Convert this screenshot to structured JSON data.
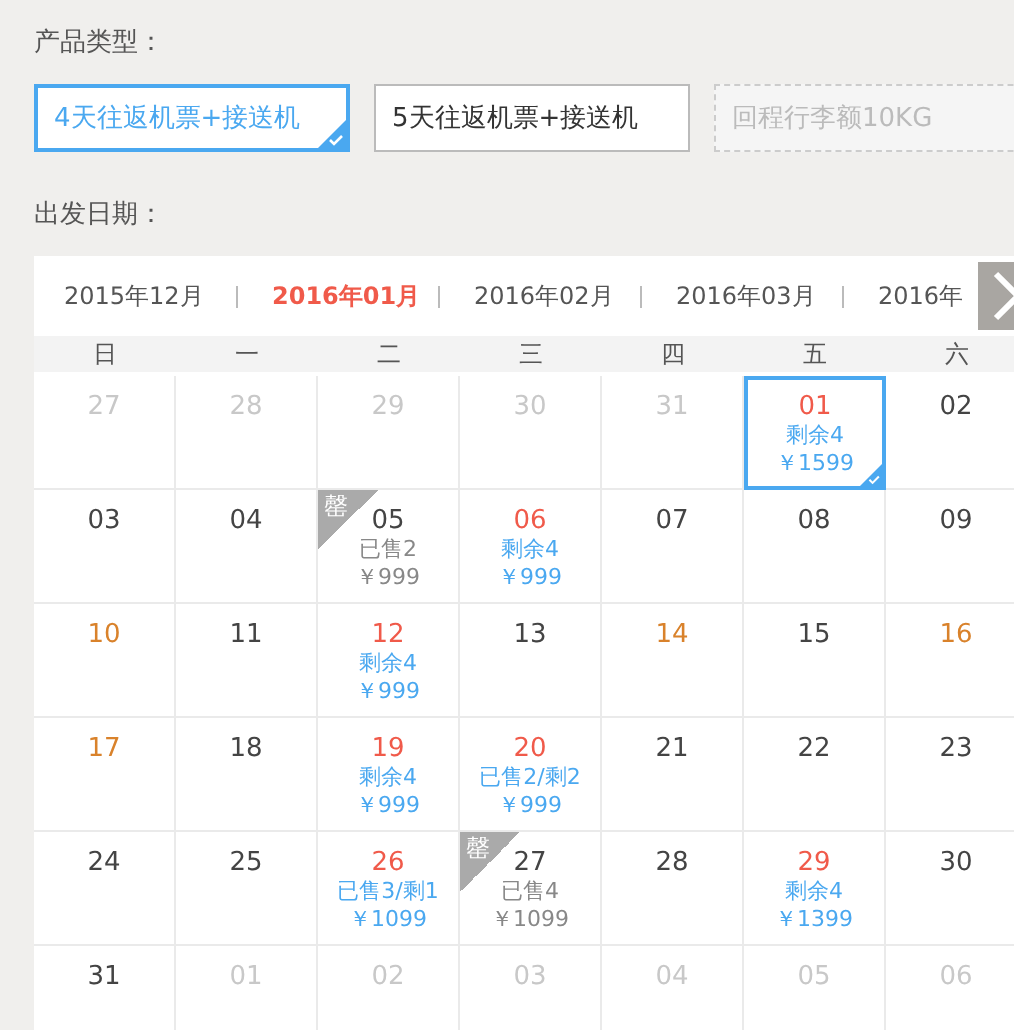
{
  "product": {
    "label": "产品类型：",
    "options": [
      {
        "label": "4天往返机票+接送机",
        "selected": true,
        "disabled": false
      },
      {
        "label": "5天往返机票+接送机",
        "selected": false,
        "disabled": false
      },
      {
        "label": "回程行李额10KG",
        "selected": false,
        "disabled": true
      }
    ]
  },
  "date": {
    "label": "出发日期："
  },
  "months": [
    {
      "label": "2015年12月",
      "selected": false
    },
    {
      "label": "2016年01月",
      "selected": true
    },
    {
      "label": "2016年02月",
      "selected": false
    },
    {
      "label": "2016年03月",
      "selected": false
    },
    {
      "label": "2016年",
      "selected": false
    }
  ],
  "weekdays": [
    "日",
    "一",
    "二",
    "三",
    "四",
    "五",
    "六"
  ],
  "days": [
    {
      "day": "27",
      "kind": "other",
      "selected": false
    },
    {
      "day": "28",
      "kind": "other",
      "selected": false
    },
    {
      "day": "29",
      "kind": "other",
      "selected": false
    },
    {
      "day": "30",
      "kind": "other",
      "selected": false
    },
    {
      "day": "31",
      "kind": "other",
      "selected": false
    },
    {
      "day": "01",
      "kind": "sale",
      "selected": true,
      "status": "剩余4",
      "price": "￥1599",
      "sold_out": false
    },
    {
      "day": "02",
      "kind": "plain",
      "selected": false
    },
    {
      "day": "03",
      "kind": "plain",
      "selected": false
    },
    {
      "day": "04",
      "kind": "plain",
      "selected": false
    },
    {
      "day": "05",
      "kind": "plain",
      "selected": false,
      "status": "已售2",
      "price": "￥999",
      "sold_out": true,
      "badge": "罄"
    },
    {
      "day": "06",
      "kind": "sale",
      "selected": false,
      "status": "剩余4",
      "price": "￥999",
      "sold_out": false
    },
    {
      "day": "07",
      "kind": "plain",
      "selected": false
    },
    {
      "day": "08",
      "kind": "plain",
      "selected": false
    },
    {
      "day": "09",
      "kind": "plain",
      "selected": false
    },
    {
      "day": "10",
      "kind": "holiday",
      "selected": false
    },
    {
      "day": "11",
      "kind": "plain",
      "selected": false
    },
    {
      "day": "12",
      "kind": "sale",
      "selected": false,
      "status": "剩余4",
      "price": "￥999",
      "sold_out": false
    },
    {
      "day": "13",
      "kind": "plain",
      "selected": false
    },
    {
      "day": "14",
      "kind": "holiday",
      "selected": false
    },
    {
      "day": "15",
      "kind": "plain",
      "selected": false
    },
    {
      "day": "16",
      "kind": "holiday",
      "selected": false
    },
    {
      "day": "17",
      "kind": "holiday",
      "selected": false
    },
    {
      "day": "18",
      "kind": "plain",
      "selected": false
    },
    {
      "day": "19",
      "kind": "sale",
      "selected": false,
      "status": "剩余4",
      "price": "￥999",
      "sold_out": false
    },
    {
      "day": "20",
      "kind": "sale",
      "selected": false,
      "status": "已售2/剩2",
      "price": "￥999",
      "sold_out": false
    },
    {
      "day": "21",
      "kind": "plain",
      "selected": false
    },
    {
      "day": "22",
      "kind": "plain",
      "selected": false
    },
    {
      "day": "23",
      "kind": "plain",
      "selected": false
    },
    {
      "day": "24",
      "kind": "plain",
      "selected": false
    },
    {
      "day": "25",
      "kind": "plain",
      "selected": false
    },
    {
      "day": "26",
      "kind": "sale",
      "selected": false,
      "status": "已售3/剩1",
      "price": "￥1099",
      "sold_out": false
    },
    {
      "day": "27",
      "kind": "plain",
      "selected": false,
      "status": "已售4",
      "price": "￥1099",
      "sold_out": true,
      "badge": "罄"
    },
    {
      "day": "28",
      "kind": "plain",
      "selected": false
    },
    {
      "day": "29",
      "kind": "sale",
      "selected": false,
      "status": "剩余4",
      "price": "￥1399",
      "sold_out": false
    },
    {
      "day": "30",
      "kind": "plain",
      "selected": false
    },
    {
      "day": "31",
      "kind": "plain",
      "selected": false
    },
    {
      "day": "01",
      "kind": "other",
      "selected": false
    },
    {
      "day": "02",
      "kind": "other",
      "selected": false
    },
    {
      "day": "03",
      "kind": "other",
      "selected": false
    },
    {
      "day": "04",
      "kind": "other",
      "selected": false
    },
    {
      "day": "05",
      "kind": "other",
      "selected": false
    },
    {
      "day": "06",
      "kind": "other",
      "selected": false
    }
  ]
}
